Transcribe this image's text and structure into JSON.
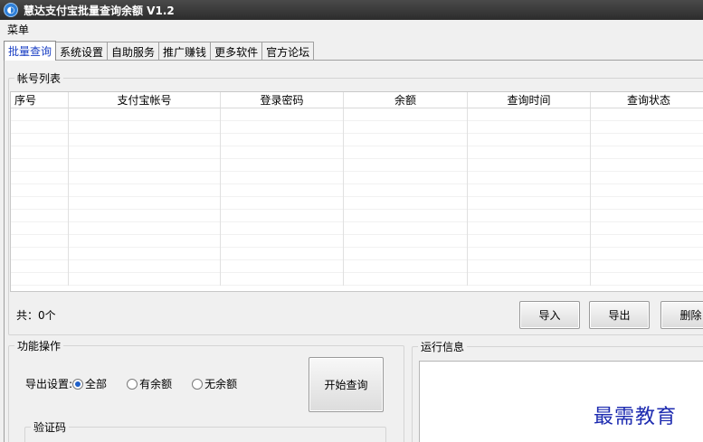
{
  "window": {
    "title": "慧达支付宝批量查询余额 V1.2",
    "icon": "app-logo-icon"
  },
  "menubar": {
    "items": [
      {
        "label": "菜单"
      }
    ]
  },
  "tabs": [
    {
      "label": "批量查询",
      "active": true
    },
    {
      "label": "系统设置",
      "active": false
    },
    {
      "label": "自助服务",
      "active": false
    },
    {
      "label": "推广赚钱",
      "active": false
    },
    {
      "label": "更多软件",
      "active": false
    },
    {
      "label": "官方论坛",
      "active": false
    }
  ],
  "account_list": {
    "title": "帐号列表",
    "columns": [
      "序号",
      "支付宝帐号",
      "登录密码",
      "余额",
      "查询时间",
      "查询状态"
    ],
    "rows": [],
    "count_label": "共：0个"
  },
  "buttons": {
    "import": "导入",
    "export": "导出",
    "delete": "删除",
    "start_query": "开始查询"
  },
  "function_ops": {
    "title": "功能操作",
    "export_setting_label": "导出设置:",
    "options": [
      {
        "label": "全部",
        "checked": true
      },
      {
        "label": "有余额",
        "checked": false
      },
      {
        "label": "无余额",
        "checked": false
      }
    ],
    "captcha_title": "验证码"
  },
  "run_info": {
    "title": "运行信息"
  },
  "watermark": "最需教育",
  "colors": {
    "active_tab_text": "#1a3fc4",
    "watermark": "#1d2bb0",
    "radio_dot": "#1e5fc9"
  }
}
